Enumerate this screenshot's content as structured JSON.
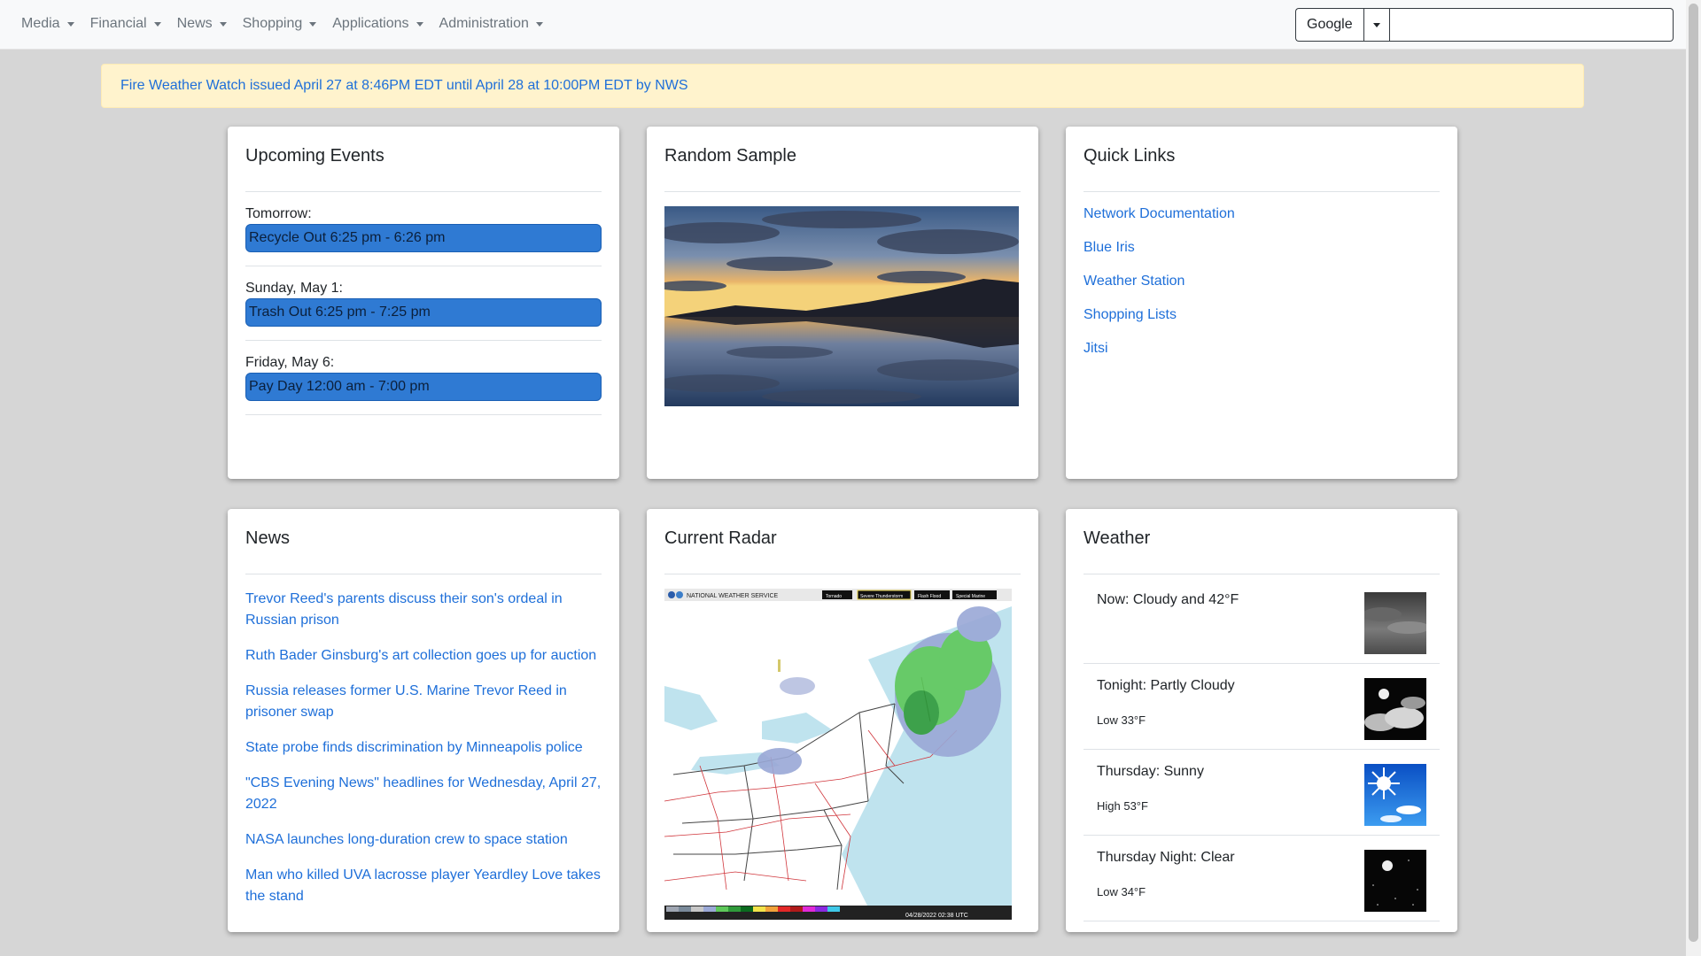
{
  "navbar": {
    "menus": [
      {
        "label": "Media"
      },
      {
        "label": "Financial"
      },
      {
        "label": "News"
      },
      {
        "label": "Shopping"
      },
      {
        "label": "Applications"
      },
      {
        "label": "Administration"
      }
    ],
    "search": {
      "engine": "Google",
      "value": "",
      "placeholder": ""
    }
  },
  "alert": {
    "text": "Fire Weather Watch issued April 27 at 8:46PM EDT until April 28 at 10:00PM EDT by NWS"
  },
  "events": {
    "title": "Upcoming Events",
    "groups": [
      {
        "date": "Tomorrow:",
        "event": "Recycle Out 6:25 pm - 6:26 pm"
      },
      {
        "date": "Sunday, May 1:",
        "event": "Trash Out 6:25 pm - 7:25 pm"
      },
      {
        "date": "Friday, May 6:",
        "event": "Pay Day 12:00 am - 7:00 pm"
      }
    ]
  },
  "sample": {
    "title": "Random Sample"
  },
  "quicklinks": {
    "title": "Quick Links",
    "links": [
      {
        "label": "Network Documentation"
      },
      {
        "label": "Blue Iris"
      },
      {
        "label": "Weather Station"
      },
      {
        "label": "Shopping Lists"
      },
      {
        "label": "Jitsi"
      }
    ]
  },
  "news": {
    "title": "News",
    "items": [
      {
        "label": "Trevor Reed's parents discuss their son's ordeal in Russian prison"
      },
      {
        "label": "Ruth Bader Ginsburg's art collection goes up for auction"
      },
      {
        "label": "Russia releases former U.S. Marine Trevor Reed in prisoner swap"
      },
      {
        "label": "State probe finds discrimination by Minneapolis police"
      },
      {
        "label": "\"CBS Evening News\" headlines for Wednesday, April 27, 2022"
      },
      {
        "label": "NASA launches long-duration crew to space station"
      },
      {
        "label": "Man who killed UVA lacrosse player Yeardley Love takes the stand"
      }
    ]
  },
  "radar": {
    "title": "Current Radar",
    "header": "NATIONAL WEATHER SERVICE",
    "legend": [
      "Tornado",
      "Severe Thunderstorm",
      "Flash Flood",
      "Special Marine"
    ],
    "timestamp": "04/28/2022 02:38 UTC"
  },
  "weather": {
    "title": "Weather",
    "rows": [
      {
        "desc": "Now: Cloudy and 42°F",
        "temp": "",
        "icon": "cloudy-icon"
      },
      {
        "desc": "Tonight: Partly Cloudy",
        "temp": "Low 33°F",
        "icon": "partly-cloudy-night-icon"
      },
      {
        "desc": "Thursday: Sunny",
        "temp": "High 53°F",
        "icon": "sunny-icon"
      },
      {
        "desc": "Thursday Night: Clear",
        "temp": "Low 34°F",
        "icon": "clear-night-icon"
      }
    ]
  }
}
